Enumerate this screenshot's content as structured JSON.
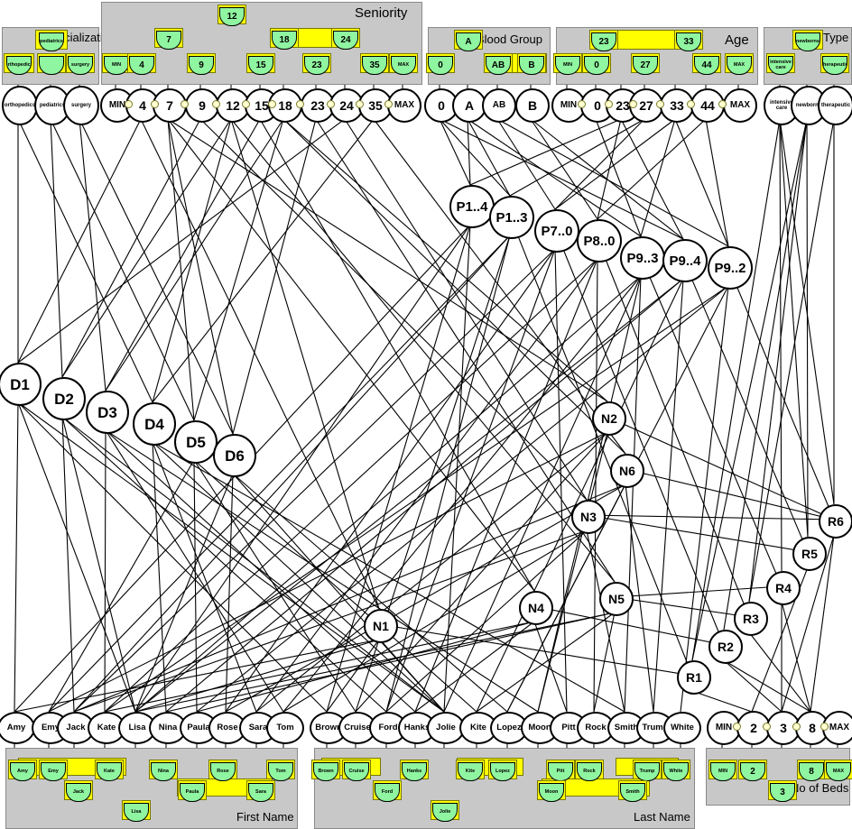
{
  "diagram": {
    "type": "nested-concept-lattice",
    "background": "#ffffff",
    "node_fill": "#8ff5a0",
    "box_fill": "#ffff00",
    "panel_fill": "#c8c8c8"
  },
  "panels": [
    {
      "id": "specialization",
      "title": "Specialization",
      "top_label": "pediatrics",
      "lattice_labels": [
        "orthopedics",
        "pediatrics",
        "surgery"
      ],
      "objects": [
        "orthopedics",
        "pediatrics",
        "surgery"
      ]
    },
    {
      "id": "seniority",
      "title": "Seniority",
      "top_label": "12",
      "lattice_labels": [
        "7",
        "18",
        "24",
        "MIN",
        "4",
        "9",
        "15",
        "23",
        "35",
        "MAX"
      ],
      "objects": [
        "MIN",
        "4",
        "7",
        "9",
        "12",
        "15",
        "18",
        "23",
        "24",
        "35",
        "MAX"
      ]
    },
    {
      "id": "blood_group",
      "title": "Blood Group",
      "top_label": "A",
      "lattice_labels": [
        "0",
        "AB",
        "B"
      ],
      "objects": [
        "0",
        "A",
        "AB",
        "B"
      ]
    },
    {
      "id": "age",
      "title": "Age",
      "top_label": "23",
      "lattice_labels": [
        "23",
        "33",
        "MIN",
        "0",
        "27",
        "44",
        "MAX"
      ],
      "objects": [
        "MIN",
        "0",
        "23",
        "27",
        "33",
        "44",
        "MAX"
      ]
    },
    {
      "id": "type",
      "title": "Type",
      "top_label": "newborns",
      "lattice_labels": [
        "intensive care",
        "newborns",
        "therapeutic"
      ],
      "objects": [
        "intensive care",
        "newborns",
        "therapeutic"
      ]
    },
    {
      "id": "first_name",
      "title": "First Name",
      "lattice_labels": [
        "Amy",
        "Emy",
        "Kate",
        "Nina",
        "Rose",
        "Tom",
        "Jack",
        "Paula",
        "Sara",
        "Lisa"
      ],
      "objects": [
        "Amy",
        "Emy",
        "Jack",
        "Kate",
        "Lisa",
        "Nina",
        "Paula",
        "Rose",
        "Sara",
        "Tom"
      ]
    },
    {
      "id": "last_name",
      "title": "Last Name",
      "lattice_labels": [
        "Brown",
        "Cruise",
        "Hanks",
        "Kite",
        "Lopez",
        "Pitt",
        "Rock",
        "Trump",
        "White",
        "Ford",
        "Moon",
        "Smith",
        "Jolie"
      ],
      "objects": [
        "Brown",
        "Cruise",
        "Ford",
        "Hanks",
        "Jolie",
        "Kite",
        "Lopez",
        "Moon",
        "Pitt",
        "Rock",
        "Smith",
        "Trump",
        "White"
      ]
    },
    {
      "id": "no_of_beds",
      "title": "No of Beds",
      "lattice_labels": [
        "MIN",
        "2",
        "8",
        "MAX",
        "3"
      ],
      "objects": [
        "MIN",
        "2",
        "3",
        "8",
        "MAX"
      ]
    }
  ],
  "center_nodes": {
    "doctors": [
      "D1",
      "D2",
      "D3",
      "D4",
      "D5",
      "D6"
    ],
    "patients": [
      "P1..4",
      "P1..3",
      "P7..0",
      "P8..0",
      "P9..3",
      "P9..4",
      "P9..2"
    ],
    "nurses": [
      "N1",
      "N2",
      "N3",
      "N4",
      "N5",
      "N6"
    ],
    "rooms": [
      "R1",
      "R2",
      "R3",
      "R4",
      "R5",
      "R6"
    ]
  }
}
